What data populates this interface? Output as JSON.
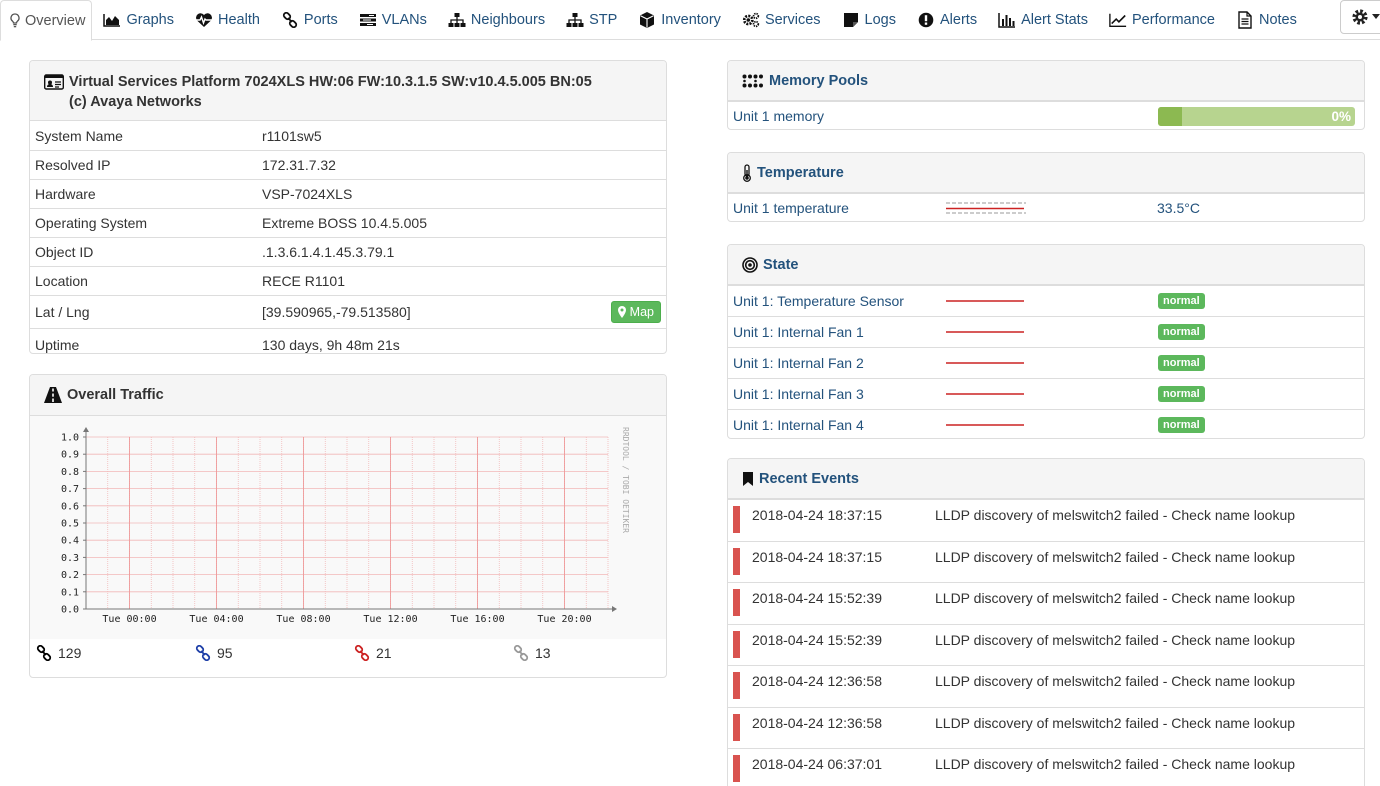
{
  "tabs": [
    {
      "label": "Overview",
      "icon": "lightbulb-icon",
      "active": true
    },
    {
      "label": "Graphs",
      "icon": "area-chart-icon"
    },
    {
      "label": "Health",
      "icon": "heartbeat-icon"
    },
    {
      "label": "Ports",
      "icon": "link-icon"
    },
    {
      "label": "VLANs",
      "icon": "tasks-icon"
    },
    {
      "label": "Neighbours",
      "icon": "sitemap-icon"
    },
    {
      "label": "STP",
      "icon": "sitemap-icon"
    },
    {
      "label": "Inventory",
      "icon": "cube-icon"
    },
    {
      "label": "Services",
      "icon": "cogs-icon"
    },
    {
      "label": "Logs",
      "icon": "sticky-note-icon"
    },
    {
      "label": "Alerts",
      "icon": "exclamation-circle-icon"
    },
    {
      "label": "Alert Stats",
      "icon": "bar-chart-icon"
    },
    {
      "label": "Performance",
      "icon": "line-chart-icon"
    },
    {
      "label": "Notes",
      "icon": "file-text-icon"
    }
  ],
  "device": {
    "title_line1": "Virtual Services Platform 7024XLS HW:06 FW:10.3.1.5 SW:v10.4.5.005 BN:05",
    "title_line2": "(c) Avaya Networks",
    "rows": [
      {
        "key": "System Name",
        "value": "r1101sw5"
      },
      {
        "key": "Resolved IP",
        "value": "172.31.7.32"
      },
      {
        "key": "Hardware",
        "value": "VSP-7024XLS"
      },
      {
        "key": "Operating System",
        "value": "Extreme BOSS 10.4.5.005"
      },
      {
        "key": "Object ID",
        "value": ".1.3.6.1.4.1.45.3.79.1"
      },
      {
        "key": "Location",
        "value": "RECE R1101"
      },
      {
        "key": "Lat / Lng",
        "value": "[39.590965,-79.513580]"
      },
      {
        "key": "Uptime",
        "value": "130 days, 9h 48m 21s"
      }
    ],
    "map_label": "Map"
  },
  "traffic": {
    "title": "Overall Traffic",
    "watermark": "RRDTOOL / TOBI OETIKER",
    "ports": [
      {
        "count": "129",
        "color": "#000000"
      },
      {
        "count": "95",
        "color": "#1e3fa8"
      },
      {
        "count": "21",
        "color": "#cc2222"
      },
      {
        "count": "13",
        "color": "#999999"
      }
    ]
  },
  "chart_data": {
    "type": "line",
    "title": "",
    "xlabel": "",
    "ylabel": "",
    "x_ticks": [
      "Tue 00:00",
      "Tue 04:00",
      "Tue 08:00",
      "Tue 12:00",
      "Tue 16:00",
      "Tue 20:00"
    ],
    "y_ticks": [
      "0.0",
      "0.1",
      "0.2",
      "0.3",
      "0.4",
      "0.5",
      "0.6",
      "0.7",
      "0.8",
      "0.9",
      "1.0"
    ],
    "ylim": [
      0,
      1.0
    ],
    "grid": true,
    "series": []
  },
  "memory": {
    "title": "Memory Pools",
    "items": [
      {
        "label": "Unit 1 memory",
        "percent": 0,
        "percent_label": "0%",
        "used_fraction": 0.12
      }
    ]
  },
  "temperature": {
    "title": "Temperature",
    "items": [
      {
        "label": "Unit 1 temperature",
        "value": "33.5°C"
      }
    ]
  },
  "state": {
    "title": "State",
    "items": [
      {
        "label": "Unit 1: Temperature Sensor",
        "status": "normal"
      },
      {
        "label": "Unit 1: Internal Fan 1",
        "status": "normal"
      },
      {
        "label": "Unit 1: Internal Fan 2",
        "status": "normal"
      },
      {
        "label": "Unit 1: Internal Fan 3",
        "status": "normal"
      },
      {
        "label": "Unit 1: Internal Fan 4",
        "status": "normal"
      }
    ]
  },
  "events": {
    "title": "Recent Events",
    "items": [
      {
        "time": "2018-04-24 18:37:15",
        "message": "LLDP discovery of melswitch2 failed - Check name lookup"
      },
      {
        "time": "2018-04-24 18:37:15",
        "message": "LLDP discovery of melswitch2 failed - Check name lookup"
      },
      {
        "time": "2018-04-24 15:52:39",
        "message": "LLDP discovery of melswitch2 failed - Check name lookup"
      },
      {
        "time": "2018-04-24 15:52:39",
        "message": "LLDP discovery of melswitch2 failed - Check name lookup"
      },
      {
        "time": "2018-04-24 12:36:58",
        "message": "LLDP discovery of melswitch2 failed - Check name lookup"
      },
      {
        "time": "2018-04-24 12:36:58",
        "message": "LLDP discovery of melswitch2 failed - Check name lookup"
      },
      {
        "time": "2018-04-24 06:37:01",
        "message": "LLDP discovery of melswitch2 failed - Check name lookup"
      }
    ]
  },
  "colors": {
    "link": "#23527c",
    "success": "#5cb85c",
    "danger": "#d9534f",
    "sparkline": "#cc2222"
  }
}
